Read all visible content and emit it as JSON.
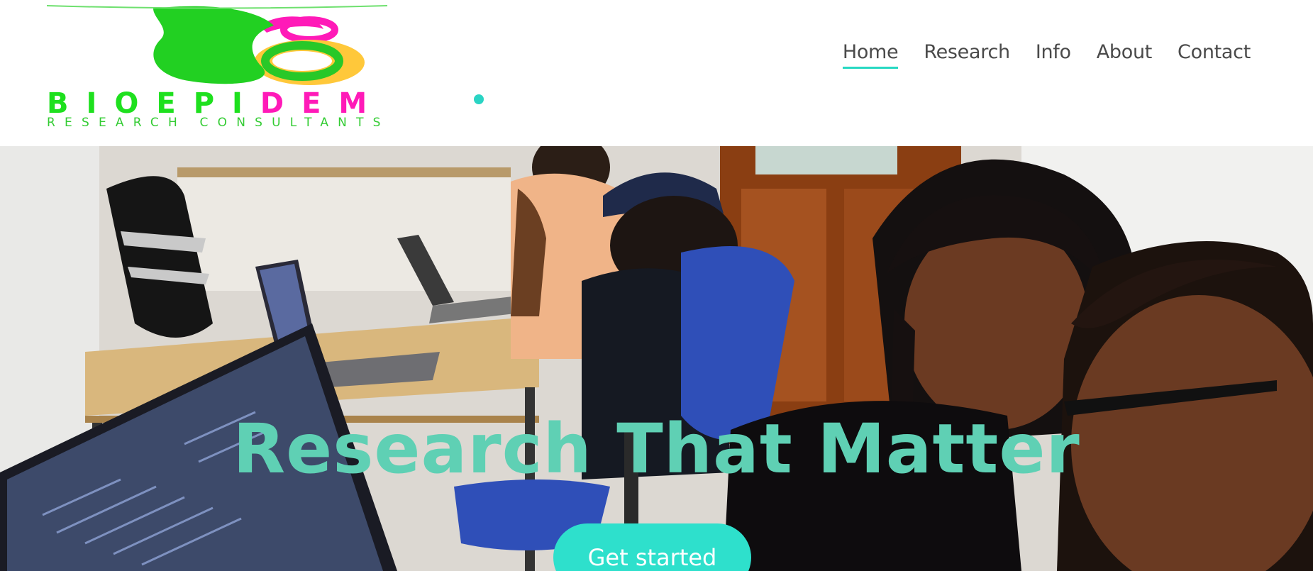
{
  "brand": {
    "wordmark_green_1": "BIOEPI",
    "wordmark_pink": "DEM",
    "tagline": "RESEARCH CONSULTANTS",
    "colors": {
      "green": "#1ee01e",
      "pink": "#ff1ab8",
      "yellow": "#ffc83a",
      "teal": "#2ad4c4"
    }
  },
  "nav": {
    "items": [
      {
        "label": "Home",
        "active": true
      },
      {
        "label": "Research",
        "active": false
      },
      {
        "label": "Info",
        "active": false
      },
      {
        "label": "About",
        "active": false
      },
      {
        "label": "Contact",
        "active": false
      }
    ],
    "accent": "#27d8c2"
  },
  "hero": {
    "title": "Research That Matter",
    "cta_label": "Get started",
    "title_color": "#5fd0b4",
    "cta_color": "#2ee0cc"
  }
}
